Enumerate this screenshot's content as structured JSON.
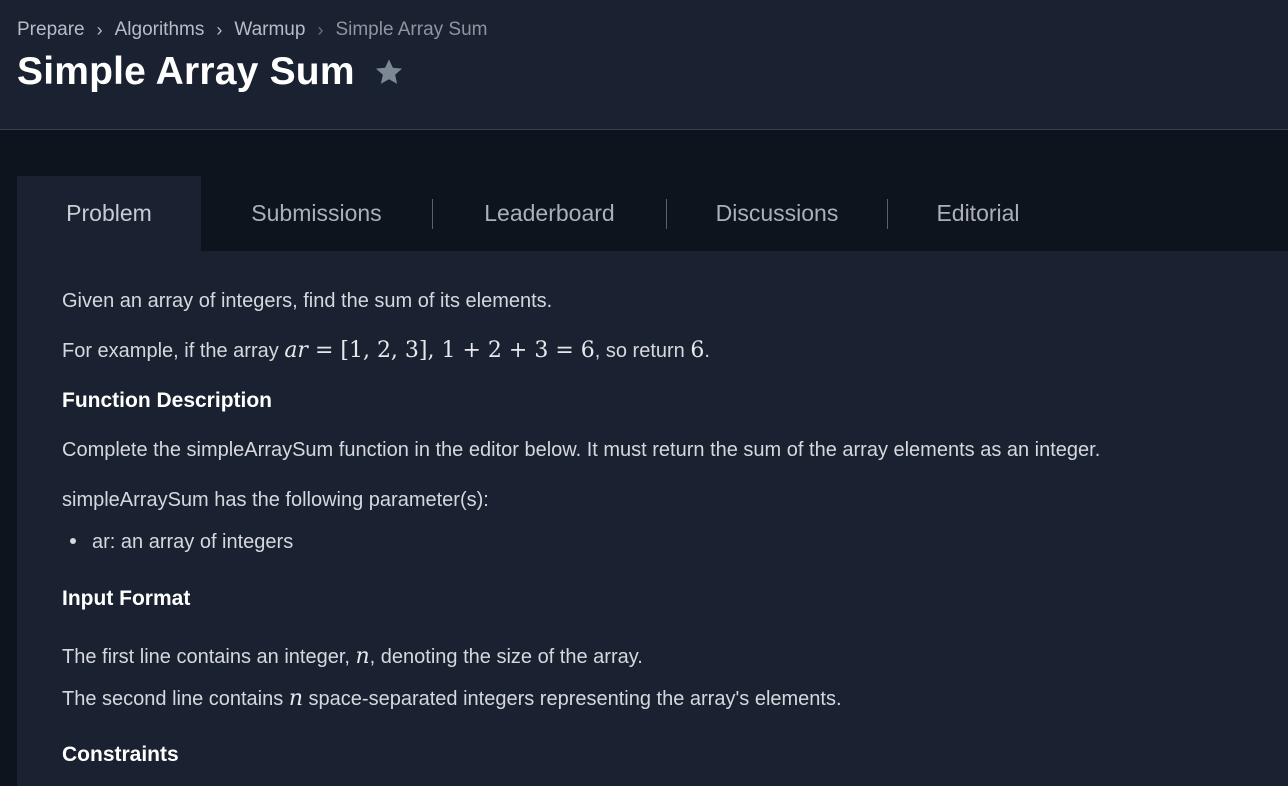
{
  "breadcrumb": {
    "items": [
      "Prepare",
      "Algorithms",
      "Warmup"
    ],
    "current": "Simple Array Sum"
  },
  "page": {
    "title": "Simple Array Sum",
    "icon": "star-icon"
  },
  "tabs": [
    {
      "label": "Problem",
      "active": true
    },
    {
      "label": "Submissions",
      "active": false
    },
    {
      "label": "Leaderboard",
      "active": false
    },
    {
      "label": "Discussions",
      "active": false
    },
    {
      "label": "Editorial",
      "active": false
    }
  ],
  "problem": {
    "intro": "Given an array of integers, find the sum of its elements.",
    "example_prefix": "For example, if the array ",
    "example_math_var": "ar",
    "example_math_expr": " = [1, 2, 3], 1 + 2 + 3 = 6",
    "example_suffix": ", so return ",
    "example_return": "6",
    "example_end": ".",
    "function_heading": "Function Description",
    "function_text": "Complete the simpleArraySum function in the editor below. It must return the sum of the array elements as an integer.",
    "params_intro": "simpleArraySum has the following parameter(s):",
    "params": [
      "ar: an array of integers"
    ],
    "input_heading": "Input Format",
    "input_line1_a": "The first line contains an integer, ",
    "input_line1_var": "n",
    "input_line1_b": ", denoting the size of the array.",
    "input_line2_a": "The second line contains ",
    "input_line2_var": "n",
    "input_line2_b": " space-separated integers representing the array's elements.",
    "constraints_heading": "Constraints"
  },
  "colors": {
    "header_bg": "#1a2130",
    "page_bg": "#0e141e",
    "title": "#ffffff",
    "star": "#7c8893"
  }
}
